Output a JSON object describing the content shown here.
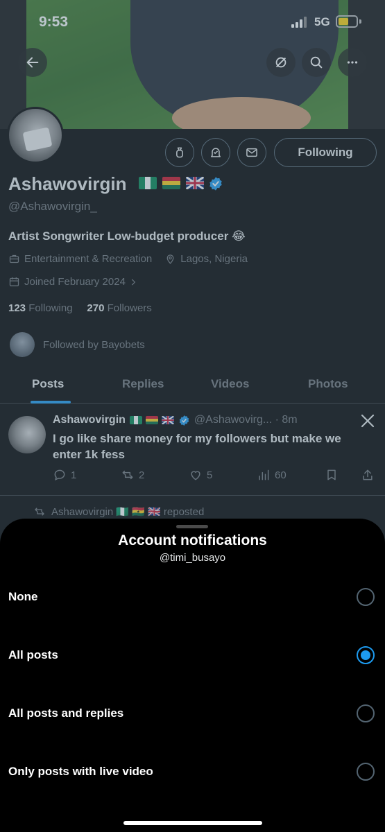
{
  "status_bar": {
    "time": "9:53",
    "network": "5G"
  },
  "profile": {
    "display_name": "Ashawovirgin",
    "handle": "@Ashawovirgin_",
    "bio": "Artist Songwriter Low-budget producer 😂",
    "category": "Entertainment & Recreation",
    "location": "Lagos, Nigeria",
    "joined": "Joined February 2024",
    "following_count": "123",
    "following_label": "Following",
    "followers_count": "270",
    "followers_label": "Followers",
    "followed_by": "Followed by Bayobets",
    "follow_button": "Following",
    "flags": [
      "nigeria-flag",
      "ghana-flag",
      "uk-flag"
    ]
  },
  "tabs": [
    "Posts",
    "Replies",
    "Videos",
    "Photos"
  ],
  "tweet": {
    "author": "Ashawovirgin",
    "handle_time": "@Ashawovirg... · 8m",
    "text": "I go like share money for my followers but make we enter 1k fess",
    "replies": "1",
    "reposts": "2",
    "likes": "5",
    "views": "60"
  },
  "repost_line": "Ashawovirgin 🇳🇬 🇬🇭 🇬🇧 reposted",
  "sheet": {
    "title": "Account notifications",
    "subtitle": "@timi_busayo",
    "options": [
      {
        "label": "None",
        "checked": false
      },
      {
        "label": "All posts",
        "checked": true
      },
      {
        "label": "All posts and replies",
        "checked": false
      },
      {
        "label": "Only posts with live video",
        "checked": false
      }
    ]
  },
  "colors": {
    "accent": "#1d9bf0",
    "muted": "#71767b",
    "background": "#000000"
  }
}
